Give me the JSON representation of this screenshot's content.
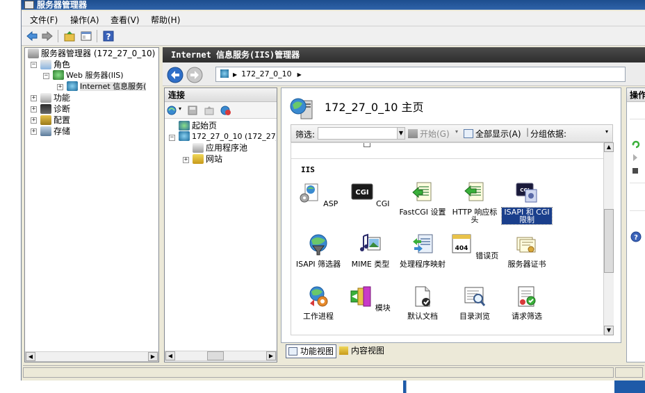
{
  "window": {
    "title": "服务器管理器"
  },
  "menu": [
    "文件(F)",
    "操作(A)",
    "查看(V)",
    "帮助(H)"
  ],
  "left_tree": {
    "root": "服务器管理器 (172_27_0_10)",
    "roles": "角色",
    "web_server": "Web 服务器(IIS)",
    "iis_manager": "Internet 信息服务(",
    "features": "功能",
    "diagnostics": "诊断",
    "configuration": "配置",
    "storage": "存储"
  },
  "iis": {
    "header": "Internet 信息服务(IIS)管理器",
    "address": "172_27_0_10",
    "connections_title": "连接",
    "conn_tree": {
      "start_page": "起始页",
      "server": "172_27_0_10 (172_27_",
      "app_pools": "应用程序池",
      "sites": "网站"
    },
    "page_title": "172_27_0_10 主页",
    "filter": {
      "label": "筛选:",
      "start": "开始(G)",
      "show_all": "全部显示(A)",
      "group_by": "分组依据:"
    },
    "group_label": "IIS",
    "features": [
      {
        "label": "ASP"
      },
      {
        "label": "CGI"
      },
      {
        "label": "FastCGI 设置"
      },
      {
        "label": "HTTP 响应标头"
      },
      {
        "label": "ISAPI 和 CGI 限制"
      },
      {
        "label": "ISAPI 筛选器"
      },
      {
        "label": "MIME 类型"
      },
      {
        "label": "处理程序映射"
      },
      {
        "label": "错误页"
      },
      {
        "label": "服务器证书"
      },
      {
        "label": "工作进程"
      },
      {
        "label": "模块"
      },
      {
        "label": "默认文档"
      },
      {
        "label": "目录浏览"
      },
      {
        "label": "请求筛选"
      }
    ],
    "selected_feature": "ISAPI 和 CGI 限制",
    "tabs": {
      "features_view": "功能视图",
      "content_view": "内容视图"
    },
    "actions_title": "操作"
  },
  "colors": {
    "selection": "#1a3f8c",
    "title_bar": "#2f63a9",
    "header_dark": "#3a3a3a"
  }
}
